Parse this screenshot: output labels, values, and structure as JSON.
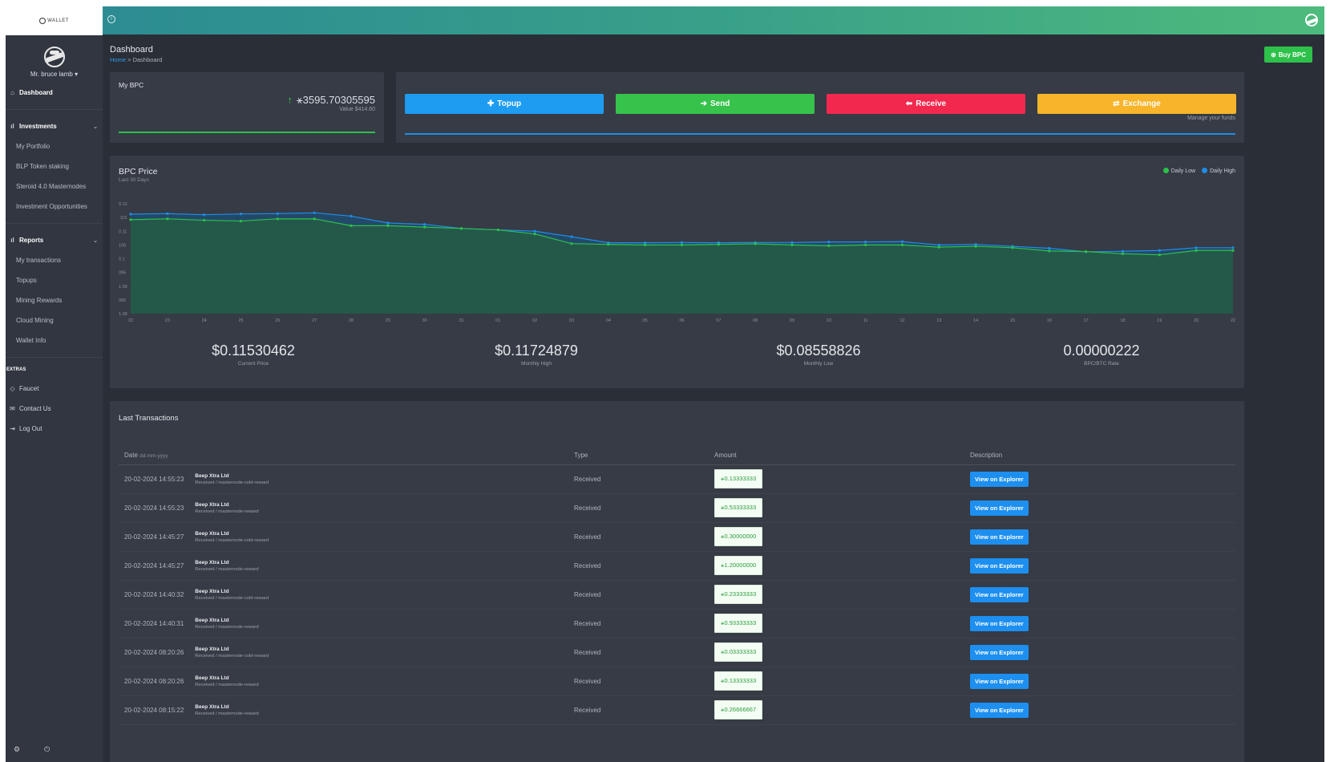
{
  "app": {
    "logo_text": "WALLET"
  },
  "user": {
    "name": "Mr. bruce lamb"
  },
  "sidebar": {
    "dashboard": "Dashboard",
    "investments": {
      "title": "Investments",
      "items": [
        "My Portfolio",
        "BLP Token staking",
        "Steroid 4.0 Masternodes",
        "Investment Opportunities"
      ]
    },
    "reports": {
      "title": "Reports",
      "items": [
        "My transactions",
        "Topups",
        "Mining Rewards",
        "Cloud Mining",
        "Wallet Info"
      ]
    },
    "extras_label": "EXTRAS",
    "extras": [
      "Faucet",
      "Contact Us",
      "Log Out"
    ]
  },
  "header": {
    "title": "Dashboard",
    "breadcrumb": {
      "home": "Home",
      "sep": ">",
      "current": "Dashboard"
    },
    "buy_label": "Buy BPC"
  },
  "mybpc": {
    "label": "My BPC",
    "balance": "3595.70305595",
    "value": "Value $414.60"
  },
  "actions": {
    "topup": "Topup",
    "send": "Send",
    "receive": "Receive",
    "exchange": "Exchange",
    "manage": "Manage your funds",
    "colors": {
      "topup": "#1e9cf2",
      "send": "#37c24b",
      "receive": "#f2284f",
      "exchange": "#f8b42a"
    }
  },
  "price": {
    "title": "BPC Price",
    "subtitle": "Last 30 Days",
    "legend": [
      {
        "name": "Daily Low",
        "color": "#2ec14a"
      },
      {
        "name": "Daily High",
        "color": "#1e8de8"
      }
    ],
    "stats": [
      {
        "value": "$0.11530462",
        "label": "Current Price"
      },
      {
        "value": "$0.11724879",
        "label": "Monthly High"
      },
      {
        "value": "$0.08558826",
        "label": "Monthly Low"
      },
      {
        "value": "0.00000222",
        "label": "BPC/BTC Rate"
      }
    ]
  },
  "chart_data": {
    "type": "area",
    "title": "BPC Price",
    "subtitle": "Last 30 Days",
    "x": [
      "22",
      "23",
      "24",
      "25",
      "26",
      "27",
      "28",
      "29",
      "30",
      "31",
      "01",
      "02",
      "03",
      "04",
      "05",
      "06",
      "07",
      "08",
      "09",
      "10",
      "11",
      "12",
      "13",
      "14",
      "15",
      "16",
      "17",
      "18",
      "19",
      "20",
      "22"
    ],
    "y_ticks": [
      "0.12",
      ".115",
      "0.11",
      "105",
      "0.1",
      "095",
      "1.09",
      "085",
      "1.08"
    ],
    "ylim": [
      0.08,
      0.12
    ],
    "series": [
      {
        "name": "Daily High",
        "color": "#1e8de8",
        "values": [
          0.1162,
          0.1164,
          0.116,
          0.1163,
          0.1164,
          0.1167,
          0.1155,
          0.113,
          0.1125,
          0.111,
          0.1105,
          0.11,
          0.108,
          0.1058,
          0.1058,
          0.1059,
          0.1058,
          0.1059,
          0.1059,
          0.1061,
          0.1061,
          0.1062,
          0.105,
          0.1052,
          0.1045,
          0.1038,
          0.1025,
          0.1027,
          0.103,
          0.104,
          0.104
        ]
      },
      {
        "name": "Daily Low",
        "color": "#2ec14a",
        "values": [
          0.1142,
          0.1145,
          0.114,
          0.1137,
          0.1145,
          0.1145,
          0.112,
          0.112,
          0.1115,
          0.111,
          0.1105,
          0.109,
          0.1055,
          0.1052,
          0.105,
          0.105,
          0.1052,
          0.1054,
          0.105,
          0.1047,
          0.105,
          0.105,
          0.1042,
          0.1045,
          0.104,
          0.1028,
          0.1026,
          0.1018,
          0.1014,
          0.103,
          0.103
        ]
      }
    ],
    "grid": false,
    "legend_position": "top-right"
  },
  "transactions": {
    "title": "Last Transactions",
    "columns": {
      "date": "Date",
      "date_hint": "dd-mm-yyyy",
      "type": "Type",
      "amount": "Amount",
      "description": "Description"
    },
    "explorer_label": "View on Explorer",
    "rows": [
      {
        "date": "20-02-2024 14:55:23",
        "name": "Beep Xtra Ltd",
        "desc": "Received / masternode-cold-reward",
        "type": "Received",
        "amount": "0.13333333"
      },
      {
        "date": "20-02-2024 14:55:23",
        "name": "Beep Xtra Ltd",
        "desc": "Received / masternode-reward",
        "type": "Received",
        "amount": "0.53333333"
      },
      {
        "date": "20-02-2024 14:45:27",
        "name": "Beep Xtra Ltd",
        "desc": "Received / masternode-cold-reward",
        "type": "Received",
        "amount": "0.30000000"
      },
      {
        "date": "20-02-2024 14:45:27",
        "name": "Beep Xtra Ltd",
        "desc": "Received / masternode-reward",
        "type": "Received",
        "amount": "1.20000000"
      },
      {
        "date": "20-02-2024 14:40:32",
        "name": "Beep Xtra Ltd",
        "desc": "Received / masternode-cold-reward",
        "type": "Received",
        "amount": "0.23333333"
      },
      {
        "date": "20-02-2024 14:40:31",
        "name": "Beep Xtra Ltd",
        "desc": "Received / masternode-reward",
        "type": "Received",
        "amount": "0.93333333"
      },
      {
        "date": "20-02-2024 08:20:26",
        "name": "Beep Xtra Ltd",
        "desc": "Received / masternode-cold-reward",
        "type": "Received",
        "amount": "0.03333333"
      },
      {
        "date": "20-02-2024 08:20:26",
        "name": "Beep Xtra Ltd",
        "desc": "Received / masternode-reward",
        "type": "Received",
        "amount": "0.13333333"
      },
      {
        "date": "20-02-2024 08:15:22",
        "name": "Beep Xtra Ltd",
        "desc": "Received / masternode-reward",
        "type": "Received",
        "amount": "0.26666667"
      }
    ]
  }
}
